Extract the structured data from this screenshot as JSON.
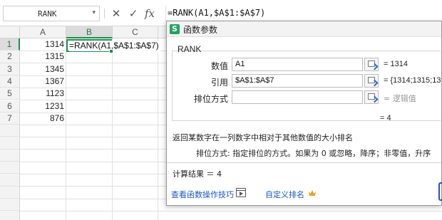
{
  "formula_bar": {
    "name_box": "RANK",
    "name_box_arrow": "▾",
    "cancel_icon": "✕",
    "confirm_icon": "✓",
    "fx_icon": "fx",
    "formula": "=RANK(A1,$A$1:$A$7)"
  },
  "sheet": {
    "columns": [
      "A",
      "B",
      "C"
    ],
    "selected_column": "B",
    "rows": [
      "1",
      "2",
      "3",
      "4",
      "5",
      "6",
      "7"
    ],
    "selected_row": "1",
    "column_a_values": [
      "1314",
      "1315",
      "1345",
      "1367",
      "1123",
      "1231",
      "876"
    ],
    "active_cell_text": "=RANK(A1,$A$1:$A$7)"
  },
  "dialog": {
    "title": "函数参数",
    "logo_letter": "S",
    "function_name": "RANK",
    "args": [
      {
        "label": "数值",
        "value": "A1",
        "result": "= 1314",
        "hint": false
      },
      {
        "label": "引用",
        "value": "$A$1:$A$7",
        "result": "= {1314;1315;13",
        "hint": false
      },
      {
        "label": "排位方式",
        "value": "",
        "result": "= 逻辑值",
        "hint": true
      }
    ],
    "formula_result": "=   4",
    "description": "返回某数字在一列数字中相对于其他数值的大小排名",
    "param_description": "排位方式:  指定排位的方式。如果为 0 或忽略，降序；非零值，升序",
    "calc_result": "计算结果 ＝  4",
    "help_link": "查看函数操作技巧",
    "custom_link": "自定义排名",
    "accent_color": "#1f8f52",
    "link_color": "#1a56c9",
    "crown_color": "#f0a020"
  }
}
